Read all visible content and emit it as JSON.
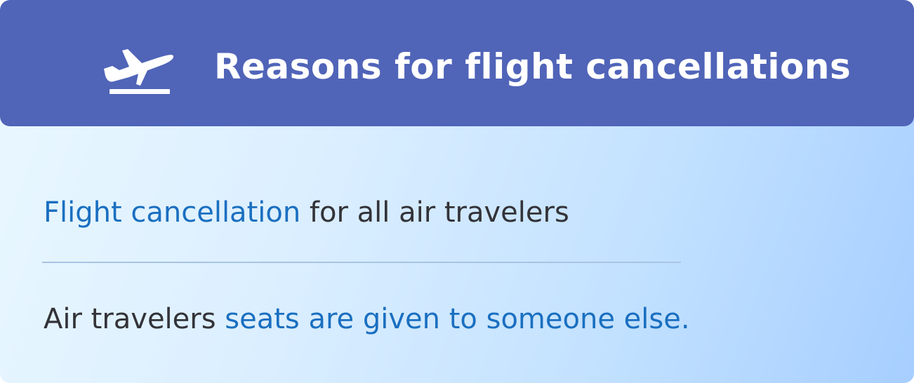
{
  "header": {
    "icon": "airplane-takeoff-icon",
    "title": "Reasons for flight cancellations"
  },
  "items": [
    {
      "highlight": "Flight cancellation",
      "text": " for all air travelers"
    },
    {
      "text": "Air travelers ",
      "highlight": "seats are given to someone else."
    }
  ],
  "colors": {
    "header_bg": "#5064b8",
    "accent": "#1a6fc0",
    "text": "#333338"
  }
}
